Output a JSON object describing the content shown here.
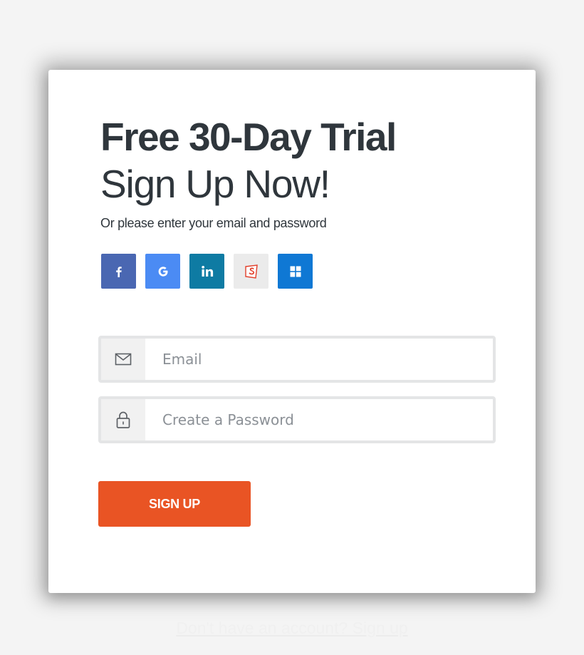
{
  "form": {
    "title_line1": "Free 30-Day Trial",
    "title_line2": "Sign Up Now!",
    "subtitle": "Or please enter your email and password",
    "social_buttons": [
      {
        "name": "facebook",
        "icon": "facebook-icon",
        "color": "#4a67b2"
      },
      {
        "name": "google",
        "icon": "google-icon",
        "color": "#4b8bf4"
      },
      {
        "name": "linkedin",
        "icon": "linkedin-icon",
        "color": "#0e7ba3"
      },
      {
        "name": "smartsheet",
        "icon": "smartsheet-icon",
        "color": "#ebebeb"
      },
      {
        "name": "microsoft",
        "icon": "microsoft-icon",
        "color": "#0f78d4"
      }
    ],
    "email": {
      "placeholder": "Email",
      "value": "",
      "icon": "envelope-icon"
    },
    "password": {
      "placeholder": "Create a Password",
      "value": "",
      "icon": "lock-icon"
    },
    "submit_label": "SIGN UP",
    "submit_color": "#e95424"
  },
  "footer": {
    "link_text": "Don't have an account? Sign up"
  }
}
